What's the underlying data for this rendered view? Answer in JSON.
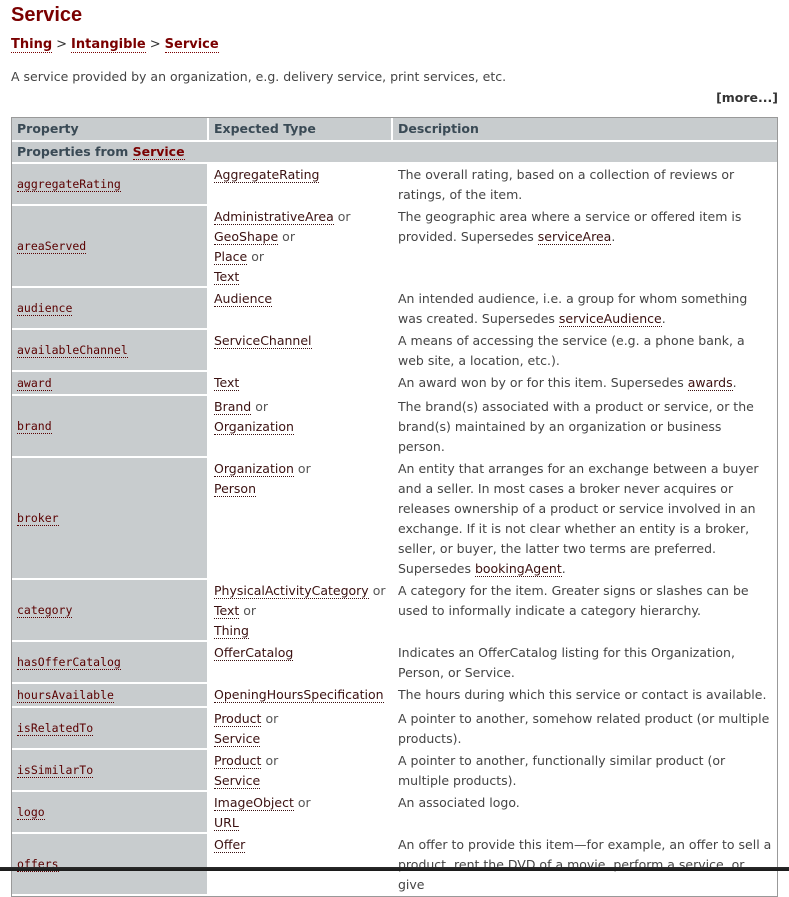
{
  "title": "Service",
  "breadcrumb": [
    {
      "label": "Thing"
    },
    {
      "label": "Intangible"
    },
    {
      "label": "Service"
    }
  ],
  "breadcrumb_separator": ">",
  "description": "A service provided by an organization, e.g. delivery service, print services, etc.",
  "more_link": "[more...]",
  "table": {
    "headers": [
      "Property",
      "Expected Type",
      "Description"
    ],
    "section_prefix": "Properties from ",
    "section_link": "Service",
    "or_label": "or",
    "rows": [
      {
        "property": "aggregateRating",
        "types": [
          "AggregateRating"
        ],
        "description": [
          {
            "t": "The overall rating, based on a collection of reviews or ratings, of the item."
          }
        ]
      },
      {
        "property": "areaServed",
        "types": [
          "AdministrativeArea",
          "GeoShape",
          "Place",
          "Text"
        ],
        "description": [
          {
            "t": "The geographic area where a service or offered item is provided. Supersedes "
          },
          {
            "link": "serviceArea"
          },
          {
            "t": "."
          }
        ]
      },
      {
        "property": "audience",
        "types": [
          "Audience"
        ],
        "description": [
          {
            "t": "An intended audience, i.e. a group for whom something was created. Supersedes "
          },
          {
            "link": "serviceAudience"
          },
          {
            "t": "."
          }
        ]
      },
      {
        "property": "availableChannel",
        "types": [
          "ServiceChannel"
        ],
        "description": [
          {
            "t": "A means of accessing the service (e.g. a phone bank, a web site, a location, etc.)."
          }
        ]
      },
      {
        "property": "award",
        "types": [
          "Text"
        ],
        "description": [
          {
            "t": "An award won by or for this item. Supersedes "
          },
          {
            "link": "awards"
          },
          {
            "t": "."
          }
        ]
      },
      {
        "property": "brand",
        "types": [
          "Brand",
          "Organization"
        ],
        "description": [
          {
            "t": "The brand(s) associated with a product or service, or the brand(s) maintained by an organization or business person."
          }
        ]
      },
      {
        "property": "broker",
        "types": [
          "Organization",
          "Person"
        ],
        "description": [
          {
            "t": "An entity that arranges for an exchange between a buyer and a seller. In most cases a broker never acquires or releases ownership of a product or service involved in an exchange. If it is not clear whether an entity is a broker, seller, or buyer, the latter two terms are preferred. Supersedes "
          },
          {
            "link": "bookingAgent"
          },
          {
            "t": "."
          }
        ]
      },
      {
        "property": "category",
        "types": [
          "PhysicalActivityCategory",
          "Text",
          "Thing"
        ],
        "description": [
          {
            "t": "A category for the item. Greater signs or slashes can be used to informally indicate a category hierarchy."
          }
        ]
      },
      {
        "property": "hasOfferCatalog",
        "types": [
          "OfferCatalog"
        ],
        "description": [
          {
            "t": "Indicates an OfferCatalog listing for this Organization, Person, or Service."
          }
        ]
      },
      {
        "property": "hoursAvailable",
        "types": [
          "OpeningHoursSpecification"
        ],
        "description": [
          {
            "t": "The hours during which this service or contact is available."
          }
        ]
      },
      {
        "property": "isRelatedTo",
        "types": [
          "Product",
          "Service"
        ],
        "description": [
          {
            "t": "A pointer to another, somehow related product (or multiple products)."
          }
        ]
      },
      {
        "property": "isSimilarTo",
        "types": [
          "Product",
          "Service"
        ],
        "description": [
          {
            "t": "A pointer to another, functionally similar product (or multiple products)."
          }
        ]
      },
      {
        "property": "logo",
        "types": [
          "ImageObject",
          "URL"
        ],
        "description": [
          {
            "t": "An associated logo."
          }
        ]
      },
      {
        "property": "offers",
        "types": [
          "Offer"
        ],
        "description": [
          {
            "t": "An offer to provide this item—for example, an offer to sell a product, rent the DVD of a movie, perform a service, or give"
          }
        ]
      }
    ]
  }
}
